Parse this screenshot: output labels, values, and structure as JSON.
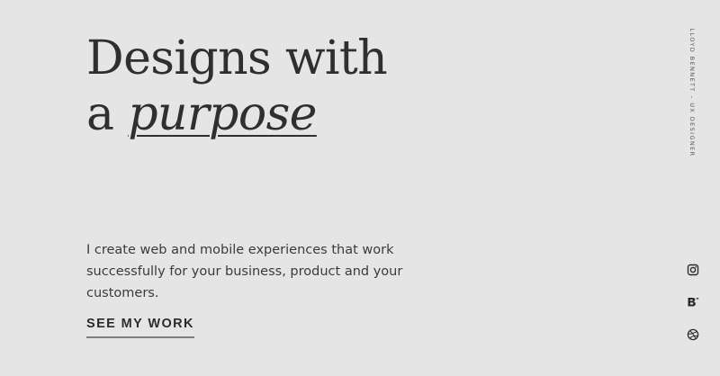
{
  "hero": {
    "line1": "Designs with",
    "line2_prefix": "a ",
    "line2_emphasis": "purpose"
  },
  "intro": {
    "text": "I create web and mobile experiences that work successfully for your business, product and your customers."
  },
  "cta": {
    "label": "SEE MY WORK"
  },
  "side_caption": {
    "text": "LLOYD BENNETT – UX DESIGNER"
  },
  "social": [
    {
      "icon": "instagram-icon"
    },
    {
      "icon": "behance-icon"
    },
    {
      "icon": "dribbble-icon"
    }
  ],
  "colors": {
    "background": "#e5e5e5",
    "text": "#2b2b2b",
    "underline": "#7f7f7f"
  }
}
